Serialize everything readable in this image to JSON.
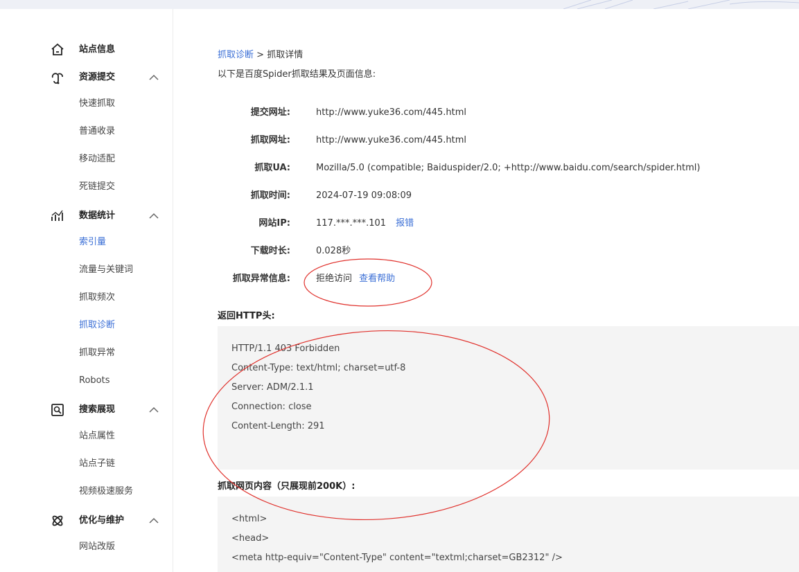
{
  "sidebar": {
    "groups": [
      {
        "label": "站点信息",
        "icon": "home-icon",
        "expandable": false,
        "items": []
      },
      {
        "label": "资源提交",
        "icon": "resource-submit-icon",
        "expandable": true,
        "items": [
          "快速抓取",
          "普通收录",
          "移动适配",
          "死链提交"
        ]
      },
      {
        "label": "数据统计",
        "icon": "stats-icon",
        "expandable": true,
        "items": [
          "索引量",
          "流量与关键词",
          "抓取频次",
          "抓取诊断",
          "抓取异常",
          "Robots"
        ]
      },
      {
        "label": "搜索展现",
        "icon": "search-display-icon",
        "expandable": true,
        "items": [
          "站点属性",
          "站点子链",
          "视频极速服务"
        ]
      },
      {
        "label": "优化与维护",
        "icon": "optimize-icon",
        "expandable": true,
        "items": [
          "网站改版"
        ]
      }
    ],
    "active_items": [
      "索引量",
      "抓取诊断"
    ]
  },
  "breadcrumb": {
    "parent": "抓取诊断",
    "separator": " > ",
    "current": "抓取详情"
  },
  "intro_text": "以下是百度Spider抓取结果及页面信息:",
  "details": {
    "submit_url": {
      "label": "提交网址:",
      "value": "http://www.yuke36.com/445.html"
    },
    "crawl_url": {
      "label": "抓取网址:",
      "value": "http://www.yuke36.com/445.html"
    },
    "crawl_ua": {
      "label": "抓取UA:",
      "value": "Mozilla/5.0 (compatible; Baiduspider/2.0; +http://www.baidu.com/search/spider.html)"
    },
    "crawl_time": {
      "label": "抓取时间:",
      "value": "2024-07-19 09:08:09"
    },
    "site_ip": {
      "label": "网站IP:",
      "value": "117.***.***.101",
      "link": "报错"
    },
    "download_time": {
      "label": "下载时长:",
      "value": "0.028秒"
    },
    "crawl_error": {
      "label": "抓取异常信息:",
      "value": "拒绝访问",
      "link": "查看帮助"
    }
  },
  "http_header": {
    "title": "返回HTTP头:",
    "lines": [
      "HTTP/1.1 403 Forbidden",
      "Content-Type: text/html; charset=utf-8",
      "Server: ADM/2.1.1",
      "Connection: close",
      "Content-Length: 291"
    ]
  },
  "page_content": {
    "title": "抓取网页内容（只展现前200K）:",
    "lines": [
      "<html>",
      "<head>",
      "<meta http-equiv=\"Content-Type\" content=\"textml;charset=GB2312\" />"
    ]
  },
  "colors": {
    "link": "#3b6fd6",
    "annotation": "#e0302b",
    "codebox_bg": "#f4f4f4"
  }
}
